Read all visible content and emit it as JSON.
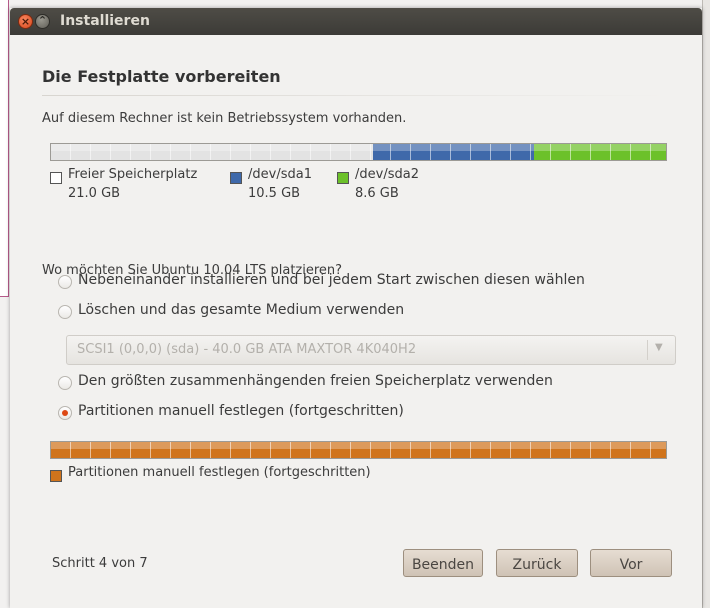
{
  "window": {
    "title": "Installieren"
  },
  "page": {
    "heading": "Die Festplatte vorbereiten",
    "message": "Auf diesem Rechner ist kein Betriebssystem vorhanden.",
    "question": "Wo möchten Sie Ubuntu 10.04 LTS platzieren?",
    "step": "Schritt 4 von 7"
  },
  "disk_bar": {
    "segments": [
      {
        "name": "Freier Speicherplatz",
        "size": "21.0 GB",
        "fraction": 0.523,
        "color": "#e3e3e3"
      },
      {
        "name": "/dev/sda1",
        "size": "10.5 GB",
        "fraction": 0.262,
        "color": "#3f69aa"
      },
      {
        "name": "/dev/sda2",
        "size": "8.6 GB",
        "fraction": 0.215,
        "color": "#6cc12a"
      }
    ]
  },
  "options": {
    "side_by_side": {
      "label": "Nebeneinander installieren und bei jedem Start zwischen diesen wählen",
      "checked": false
    },
    "erase_disk": {
      "label": "Löschen und das gesamte Medium verwenden",
      "checked": false
    },
    "largest_free": {
      "label": "Den größten zusammenhängenden freien Speicherplatz verwenden",
      "checked": false
    },
    "manual": {
      "label": "Partitionen manuell festlegen (fortgeschritten)",
      "checked": true
    }
  },
  "disk_select": {
    "value": "SCSI1 (0,0,0) (sda) - 40.0 GB ATA MAXTOR 4K040H2",
    "icon": "chevron-down-icon"
  },
  "manual_bar": {
    "label": "Partitionen manuell festlegen (fortgeschritten)",
    "fraction": 1.0,
    "color": "#d0741c"
  },
  "buttons": {
    "quit": "Beenden",
    "back": "Zurück",
    "forward": "Vor"
  }
}
